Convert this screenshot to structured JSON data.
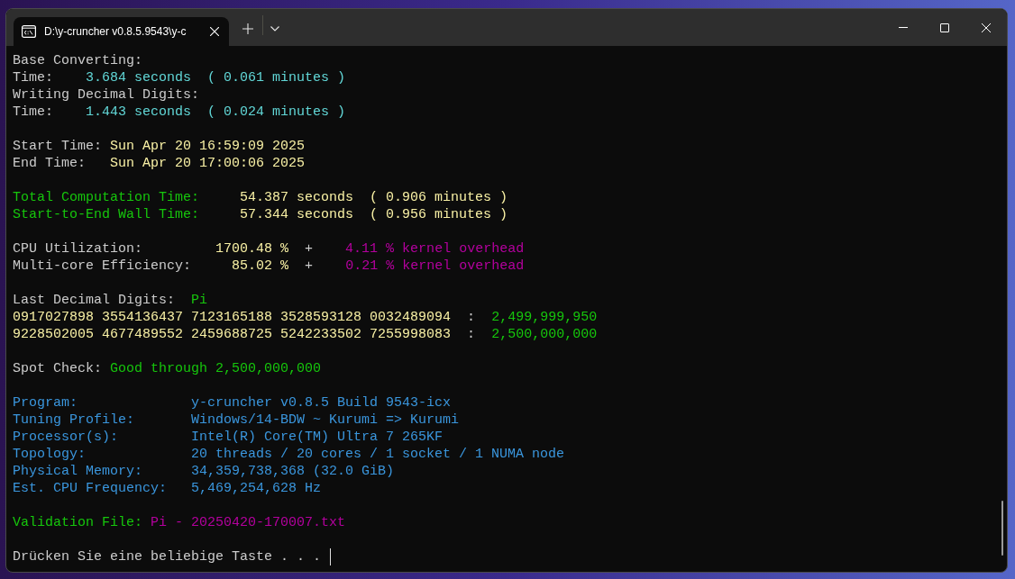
{
  "window": {
    "tabs": [
      {
        "title": "D:\\y-cruncher v0.8.5.9543\\y-c",
        "selected": true
      }
    ]
  },
  "terminal": {
    "cursor": true,
    "lines": [
      {
        "kind": "text",
        "segments": [
          {
            "text": "Base Converting:",
            "color": "#cccccc"
          }
        ]
      },
      {
        "kind": "text",
        "segments": [
          {
            "text": "Time:",
            "color": "#cccccc"
          },
          {
            "text": "    3.684 seconds  ( 0.061 minutes )",
            "color": "#61d6d6"
          }
        ]
      },
      {
        "kind": "text",
        "segments": [
          {
            "text": "Writing Decimal Digits:",
            "color": "#cccccc"
          }
        ]
      },
      {
        "kind": "text",
        "segments": [
          {
            "text": "Time:",
            "color": "#cccccc"
          },
          {
            "text": "    1.443 seconds  ( 0.024 minutes )",
            "color": "#61d6d6"
          }
        ]
      },
      {
        "kind": "blank"
      },
      {
        "kind": "text",
        "segments": [
          {
            "text": "Start Time:",
            "color": "#cccccc"
          },
          {
            "text": " Sun Apr 20 16:59:09 2025",
            "color": "#f9f1a5"
          }
        ]
      },
      {
        "kind": "text",
        "segments": [
          {
            "text": "End Time:",
            "color": "#cccccc"
          },
          {
            "text": "   Sun Apr 20 17:00:06 2025",
            "color": "#f9f1a5"
          }
        ]
      },
      {
        "kind": "blank"
      },
      {
        "kind": "text",
        "segments": [
          {
            "text": "Total Computation Time:",
            "color": "#16c60c"
          },
          {
            "text": "     54.387 seconds  ( 0.906 minutes )",
            "color": "#f9f1a5"
          }
        ]
      },
      {
        "kind": "text",
        "segments": [
          {
            "text": "Start-to-End Wall Time:",
            "color": "#16c60c"
          },
          {
            "text": "     57.344 seconds  ( 0.956 minutes )",
            "color": "#f9f1a5"
          }
        ]
      },
      {
        "kind": "blank"
      },
      {
        "kind": "text",
        "segments": [
          {
            "text": "CPU Utilization:",
            "color": "#cccccc"
          },
          {
            "text": "         1700.48 %",
            "color": "#f9f1a5"
          },
          {
            "text": "  +",
            "color": "#cccccc"
          },
          {
            "text": "    4.11 % kernel overhead",
            "color": "#b4009e"
          }
        ]
      },
      {
        "kind": "text",
        "segments": [
          {
            "text": "Multi-core Efficiency:",
            "color": "#cccccc"
          },
          {
            "text": "     85.02 %",
            "color": "#f9f1a5"
          },
          {
            "text": "  +",
            "color": "#cccccc"
          },
          {
            "text": "    0.21 % kernel overhead",
            "color": "#b4009e"
          }
        ]
      },
      {
        "kind": "blank"
      },
      {
        "kind": "text",
        "segments": [
          {
            "text": "Last Decimal Digits:",
            "color": "#cccccc"
          },
          {
            "text": "  Pi",
            "color": "#16c60c"
          }
        ]
      },
      {
        "kind": "text",
        "segments": [
          {
            "text": "0917027898 3554136437 7123165188 3528593128 0032489094",
            "color": "#f9f1a5"
          },
          {
            "text": "  :",
            "color": "#cccccc"
          },
          {
            "text": "  2,499,999,950",
            "color": "#16c60c"
          }
        ]
      },
      {
        "kind": "text",
        "segments": [
          {
            "text": "9228502005 4677489552 2459688725 5242233502 7255998083",
            "color": "#f9f1a5"
          },
          {
            "text": "  :",
            "color": "#cccccc"
          },
          {
            "text": "  2,500,000,000",
            "color": "#16c60c"
          }
        ]
      },
      {
        "kind": "blank"
      },
      {
        "kind": "text",
        "segments": [
          {
            "text": "Spot Check:",
            "color": "#cccccc"
          },
          {
            "text": " Good through 2,500,000,000",
            "color": "#16c60c"
          }
        ]
      },
      {
        "kind": "blank"
      },
      {
        "kind": "text",
        "segments": [
          {
            "text": "Program:",
            "color": "#3a96dd"
          },
          {
            "text": "              y-cruncher v0.8.5 Build 9543-icx",
            "color": "#3a96dd"
          }
        ]
      },
      {
        "kind": "text",
        "segments": [
          {
            "text": "Tuning Profile:",
            "color": "#3a96dd"
          },
          {
            "text": "       Windows/14-BDW ~ Kurumi => Kurumi",
            "color": "#3a96dd"
          }
        ]
      },
      {
        "kind": "text",
        "segments": [
          {
            "text": "Processor(s):",
            "color": "#3a96dd"
          },
          {
            "text": "         Intel(R) Core(TM) Ultra 7 265KF",
            "color": "#3a96dd"
          }
        ]
      },
      {
        "kind": "text",
        "segments": [
          {
            "text": "Topology:",
            "color": "#3a96dd"
          },
          {
            "text": "             20 threads / 20 cores / 1 socket / 1 NUMA node",
            "color": "#3a96dd"
          }
        ]
      },
      {
        "kind": "text",
        "segments": [
          {
            "text": "Physical Memory:",
            "color": "#3a96dd"
          },
          {
            "text": "      34,359,738,368 (32.0 GiB)",
            "color": "#3a96dd"
          }
        ]
      },
      {
        "kind": "text",
        "segments": [
          {
            "text": "Est. CPU Frequency:",
            "color": "#3a96dd"
          },
          {
            "text": "   5,469,254,628 Hz",
            "color": "#3a96dd"
          }
        ]
      },
      {
        "kind": "blank"
      },
      {
        "kind": "text",
        "segments": [
          {
            "text": "Validation File:",
            "color": "#16c60c"
          },
          {
            "text": " Pi - 20250420-170007.txt",
            "color": "#b4009e"
          }
        ]
      },
      {
        "kind": "blank"
      },
      {
        "kind": "text",
        "segments": [
          {
            "text": "Drücken Sie eine beliebige Taste . . .",
            "color": "#cccccc"
          }
        ]
      }
    ]
  }
}
